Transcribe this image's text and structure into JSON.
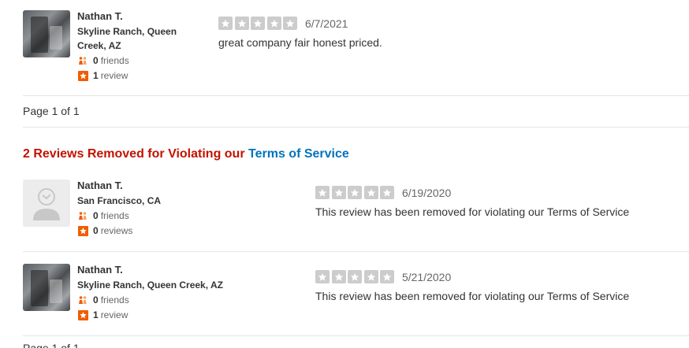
{
  "top_review": {
    "user": {
      "name": "Nathan T.",
      "location": "Skyline Ranch, Queen Creek, AZ",
      "friends_count": "0",
      "friends_label": "friends",
      "reviews_count": "1",
      "reviews_label": "review"
    },
    "rating": 5,
    "date": "6/7/2021",
    "text": "great company fair honest priced."
  },
  "pagination": {
    "text": "Page 1 of 1"
  },
  "removed_section": {
    "heading_prefix": "2 Reviews Removed for Violating our",
    "heading_link": "Terms of Service",
    "reviews": [
      {
        "user": {
          "name": "Nathan T.",
          "location": "San Francisco, CA",
          "friends_count": "0",
          "friends_label": "friends",
          "reviews_count": "0",
          "reviews_label": "reviews"
        },
        "rating": 5,
        "date": "6/19/2020",
        "text": "This review has been removed for violating our Terms of Service"
      },
      {
        "user": {
          "name": "Nathan T.",
          "location": "Skyline Ranch, Queen Creek, AZ",
          "friends_count": "0",
          "friends_label": "friends",
          "reviews_count": "1",
          "reviews_label": "review"
        },
        "rating": 5,
        "date": "5/21/2020",
        "text": "This review has been removed for violating our Terms of Service"
      }
    ]
  },
  "truncated_text": "Page 1 of 1",
  "colors": {
    "star_filled": "#cccccc",
    "removed_heading": "#c41200",
    "link": "#0073bb",
    "friends_icon": "#f15c00",
    "review_icon": "#f15c00"
  },
  "icons": {
    "friends": "friends-icon",
    "review": "review-star-icon",
    "star": "rating-star-icon",
    "avatar_placeholder": "default-avatar-icon"
  }
}
